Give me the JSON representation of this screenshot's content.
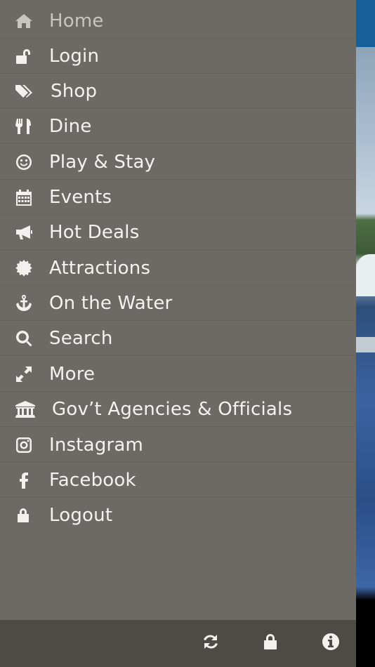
{
  "menu": {
    "items": [
      {
        "label": "Home",
        "icon": "home-icon"
      },
      {
        "label": "Login",
        "icon": "unlock-icon"
      },
      {
        "label": "Shop",
        "icon": "tags-icon"
      },
      {
        "label": "Dine",
        "icon": "cutlery-icon"
      },
      {
        "label": "Play & Stay",
        "icon": "smile-icon"
      },
      {
        "label": "Events",
        "icon": "calendar-icon"
      },
      {
        "label": "Hot Deals",
        "icon": "megaphone-icon"
      },
      {
        "label": "Attractions",
        "icon": "badge-icon"
      },
      {
        "label": "On the Water",
        "icon": "anchor-icon"
      },
      {
        "label": "Search",
        "icon": "search-icon"
      },
      {
        "label": "More",
        "icon": "expand-icon"
      },
      {
        "label": "Gov’t Agencies & Officials",
        "icon": "institution-icon"
      },
      {
        "label": "Instagram",
        "icon": "instagram-icon"
      },
      {
        "label": "Facebook",
        "icon": "facebook-icon"
      },
      {
        "label": "Logout",
        "icon": "lock-icon"
      }
    ]
  },
  "toolbar": {
    "buttons": [
      {
        "icon": "refresh-icon"
      },
      {
        "icon": "lock-icon"
      },
      {
        "icon": "info-icon"
      }
    ]
  },
  "colors": {
    "drawer_bg": "#6d6a65",
    "toolbar_bg": "#4e4b47",
    "text": "#f4f3f1",
    "accent_bar": "#16609a"
  }
}
